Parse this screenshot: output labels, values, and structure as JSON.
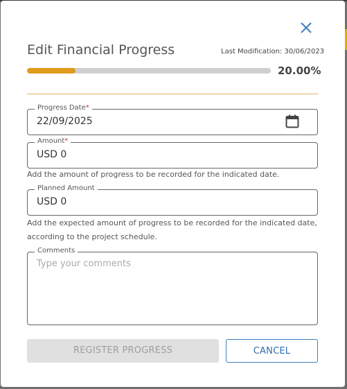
{
  "modal": {
    "title": "Edit Financial Progress",
    "last_modification": "Last Modification: 30/06/2023",
    "progress_percent": 20,
    "progress_label": "20.00%",
    "close_icon": "close-icon"
  },
  "fields": {
    "progress_date": {
      "label": "Progress Date",
      "required_mark": "*",
      "value": "22/09/2025",
      "icon": "calendar-icon"
    },
    "amount": {
      "label": "Amount",
      "required_mark": "*",
      "value": "USD 0",
      "help": "Add the amount of progress to be recorded for the indicated date."
    },
    "planned_amount": {
      "label": "Planned Amount",
      "value": "USD 0",
      "help": "Add the expected amount of progress to be recorded for the indicated date, according to the project schedule."
    },
    "comments": {
      "label": "Comments",
      "placeholder": "Type your comments"
    }
  },
  "buttons": {
    "register": "REGISTER PROGRESS",
    "cancel": "CANCEL"
  },
  "colors": {
    "accent": "#e09a1c",
    "primary": "#2f6db0",
    "required": "#d32f2f"
  }
}
